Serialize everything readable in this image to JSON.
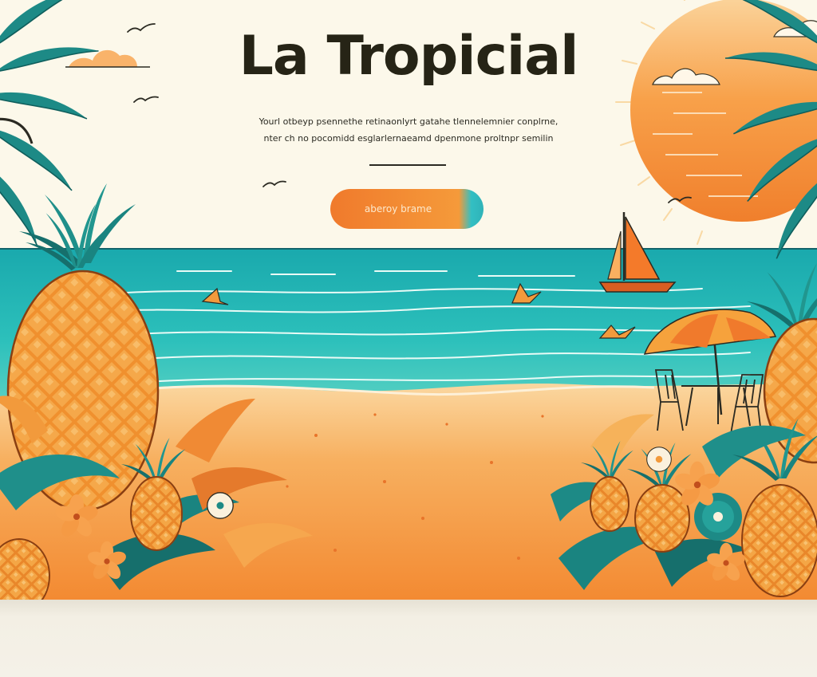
{
  "hero": {
    "title": "La Tropicial",
    "tagline_line1": "Yourl otbeyp psennethe retinaonlyrt gatahe tlennelemnier conplrne,",
    "tagline_line2": "nter ch no pocomidd esglarlernaeamd dpenmone proltnpr semilin",
    "cta_label": "aberoy brame"
  },
  "colors": {
    "background": "#fcf8ea",
    "ink": "#262416",
    "sun": "#f7923a",
    "sea": "#27b7b5",
    "sand": "#f6a44c",
    "leaf": "#1d8a86",
    "pineapple": "#ee8a2c"
  },
  "icons": [
    "palm-tree-icon",
    "pineapple-icon",
    "sun-icon",
    "cloud-icon",
    "bird-icon",
    "sailboat-icon",
    "beach-umbrella-icon",
    "table-icon",
    "chair-icon",
    "hibiscus-icon",
    "monstera-leaf-icon"
  ]
}
